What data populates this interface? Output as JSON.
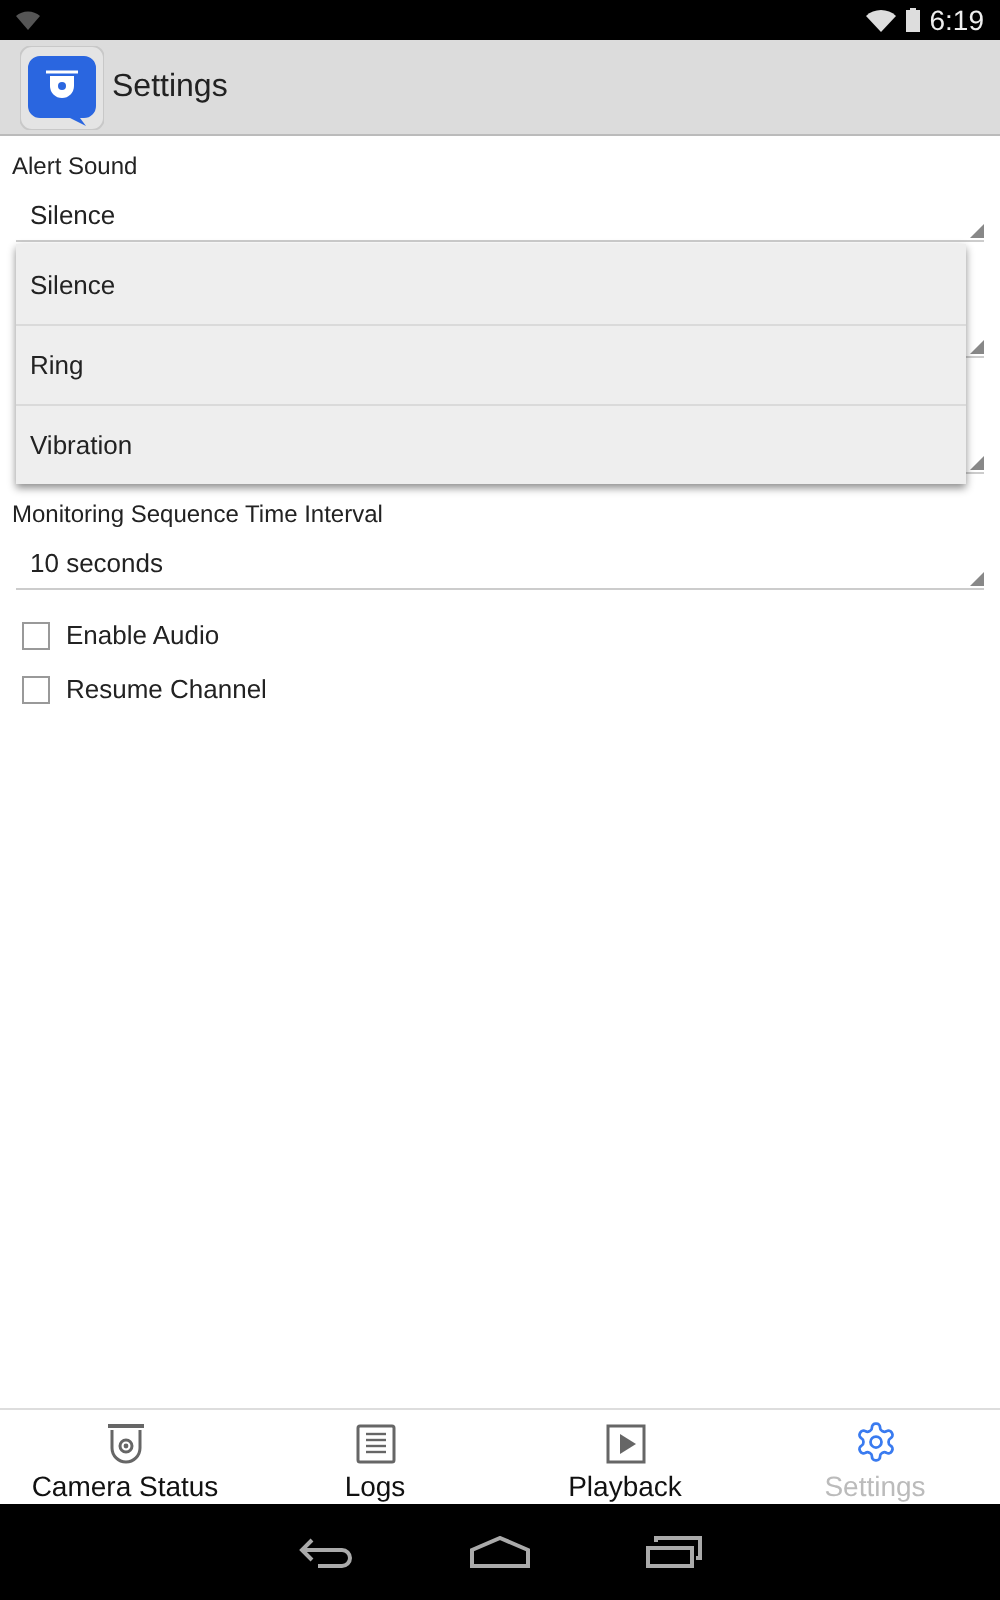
{
  "status_bar": {
    "time": "6:19"
  },
  "app_bar": {
    "title": "Settings"
  },
  "settings": [
    {
      "kind": "spinner",
      "label": "Alert Sound",
      "value": "Silence"
    },
    {
      "kind": "hidden"
    },
    {
      "kind": "hidden"
    },
    {
      "kind": "spinner",
      "label": "Monitoring Sequence Time Interval",
      "value": "10 seconds"
    },
    {
      "kind": "checkbox",
      "label": "Enable Audio",
      "checked": false
    },
    {
      "kind": "checkbox",
      "label": "Resume Channel",
      "checked": false
    }
  ],
  "dropdown": {
    "options": [
      {
        "label": "Silence"
      },
      {
        "label": "Ring"
      },
      {
        "label": "Vibration"
      }
    ]
  },
  "tabs": [
    {
      "label": "Camera Status",
      "kind": "camera",
      "selected": false
    },
    {
      "label": "Logs",
      "kind": "logs",
      "selected": false
    },
    {
      "label": "Playback",
      "kind": "playback",
      "selected": false
    },
    {
      "label": "Settings",
      "kind": "settings",
      "selected": true
    }
  ]
}
